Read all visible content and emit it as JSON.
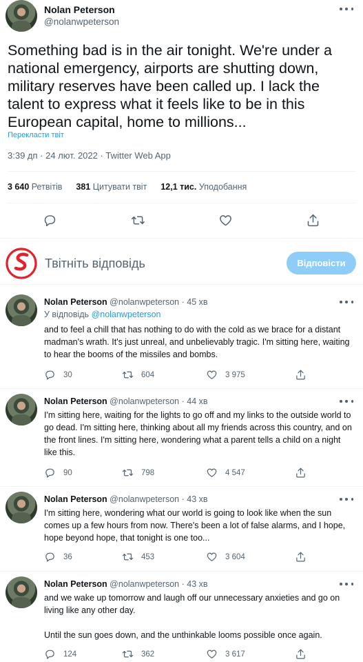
{
  "main_tweet": {
    "author_name": "Nolan Peterson",
    "author_handle": "@nolanwpeterson",
    "text": "Something bad is in the air tonight. We're under a national emergency, airports are shutting down, military reserves have been called up. I lack the talent to express what it feels like to be in this European capital, home to millions...",
    "translate_label": "Перекласти твіт",
    "timestamp": "3:39 дп · 24 лют. 2022 · Twitter Web App",
    "stats": {
      "retweets_count": "3 640",
      "retweets_label": "Ретвітів",
      "quotes_count": "381",
      "quotes_label": "Цитувати твіт",
      "likes_count": "12,1 тис.",
      "likes_label": "Уподобання"
    },
    "actions": [
      "reply-icon",
      "retweet-icon",
      "like-icon",
      "share-icon"
    ]
  },
  "composer": {
    "placeholder": "Твітніть відповідь",
    "reply_button": "Відповісти",
    "reply_button_color": "#8ecdf8"
  },
  "replies": [
    {
      "name": "Nolan Peterson",
      "handle": "@nolanwpeterson",
      "time": "· 45 хв",
      "reply_to_label": "У відповідь",
      "reply_to_handle": "@nolanwpeterson",
      "text": "and to feel a chill that has nothing to do with the cold as we brace for a distant madman's wrath. It's just unreal, and unbelievably tragic. I'm sitting here, waiting to hear the booms of the missiles and bombs.",
      "replies": "30",
      "retweets": "604",
      "likes": "3 975"
    },
    {
      "name": "Nolan Peterson",
      "handle": "@nolanwpeterson",
      "time": "· 44 хв",
      "text": "I'm sitting here, waiting for the lights to go off and my links to the outside world to go dead. I'm sitting here, thinking about all my friends across this country, and on the front lines. I'm sitting here, wondering what a parent tells a child on a night like this.",
      "replies": "90",
      "retweets": "798",
      "likes": "4 547"
    },
    {
      "name": "Nolan Peterson",
      "handle": "@nolanwpeterson",
      "time": "· 43 хв",
      "text": "I'm sitting here, wondering what our world is going to look like when the sun comes up a few hours from now. There's been a lot of false alarms, and I hope, hope beyond hope, that tonight is one too...",
      "replies": "36",
      "retweets": "453",
      "likes": "3 604"
    },
    {
      "name": "Nolan Peterson",
      "handle": "@nolanwpeterson",
      "time": "· 43 хв",
      "text": "and we wake up tomorrow and laugh off our unnecessary anxieties and go on living like any other day.",
      "text2": "Until the sun goes down, and the unthinkable looms possible once again.",
      "replies": "124",
      "retweets": "362",
      "likes": "3 617"
    }
  ],
  "colors": {
    "accent": "#1d9bf0",
    "secondary_text": "#536471",
    "primary_text": "#0f1419",
    "logo_red": "#e0242c"
  }
}
